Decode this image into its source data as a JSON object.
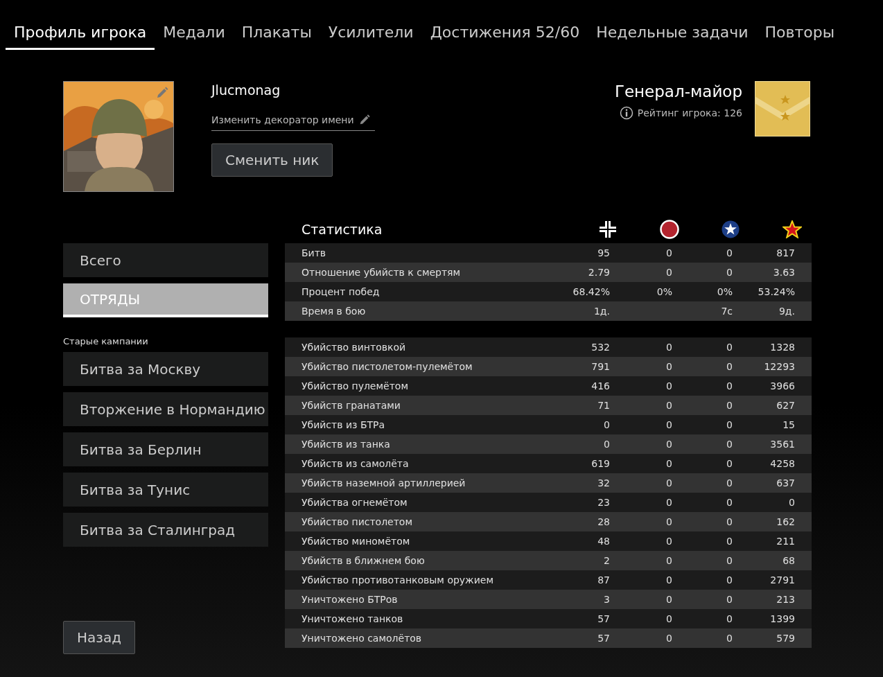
{
  "tabs": [
    {
      "label": "Профиль игрока",
      "selected": true
    },
    {
      "label": "Медали",
      "selected": false
    },
    {
      "label": "Плакаты",
      "selected": false
    },
    {
      "label": "Усилители",
      "selected": false
    },
    {
      "label": "Достижения 52/60",
      "selected": false
    },
    {
      "label": "Недельные задачи",
      "selected": false
    },
    {
      "label": "Повторы",
      "selected": false
    }
  ],
  "profile": {
    "nickname": "Jlucmonag",
    "decorator_link": "Изменить декоратор имени",
    "change_nick_button": "Сменить ник",
    "rank": "Генерал-майор",
    "rating": "Рейтинг игрока: 126"
  },
  "sidebar": {
    "items": [
      {
        "label": "Всего",
        "selected": false
      },
      {
        "label": "ОТРЯДЫ",
        "selected": true
      }
    ],
    "section_label": "Старые кампании",
    "campaigns": [
      {
        "label": "Битва за Москву",
        "selected": false
      },
      {
        "label": "Вторжение в Нормандию",
        "selected": false
      },
      {
        "label": "Битва за Берлин",
        "selected": false
      },
      {
        "label": "Битва за Тунис",
        "selected": false
      },
      {
        "label": "Битва за Сталинград",
        "selected": false
      }
    ],
    "back_button": "Назад"
  },
  "stats": {
    "title": "Статистика",
    "factions": [
      {
        "kind": "cross"
      },
      {
        "kind": "disc"
      },
      {
        "kind": "roundel"
      },
      {
        "kind": "star"
      }
    ],
    "groups": [
      [
        {
          "label": "Битв",
          "values": {
            "cross": "95",
            "disc": "0",
            "roundel": "0",
            "star": "817"
          }
        },
        {
          "label": "Отношение убийств к смертям",
          "values": {
            "cross": "2.79",
            "disc": "0",
            "roundel": "0",
            "star": "3.63"
          }
        },
        {
          "label": "Процент побед",
          "values": {
            "cross": "68.42%",
            "disc": "0%",
            "roundel": "0%",
            "star": "53.24%"
          }
        },
        {
          "label": "Время в бою",
          "values": {
            "cross": "1д.",
            "roundel": "7с",
            "star": "9д."
          }
        }
      ],
      [
        {
          "label": "Убийство винтовкой",
          "values": {
            "cross": "532",
            "disc": "0",
            "roundel": "0",
            "star": "1328"
          }
        },
        {
          "label": "Убийство пистолетом-пулемётом",
          "values": {
            "cross": "791",
            "disc": "0",
            "roundel": "0",
            "star": "12293"
          }
        },
        {
          "label": "Убийство пулемётом",
          "values": {
            "cross": "416",
            "disc": "0",
            "roundel": "0",
            "star": "3966"
          }
        },
        {
          "label": "Убийств гранатами",
          "values": {
            "cross": "71",
            "disc": "0",
            "roundel": "0",
            "star": "627"
          }
        },
        {
          "label": "Убийств из БТРа",
          "values": {
            "cross": "0",
            "disc": "0",
            "roundel": "0",
            "star": "15"
          }
        },
        {
          "label": "Убийств из танка",
          "values": {
            "cross": "0",
            "disc": "0",
            "roundel": "0",
            "star": "3561"
          }
        },
        {
          "label": "Убийств из самолёта",
          "values": {
            "cross": "619",
            "disc": "0",
            "roundel": "0",
            "star": "4258"
          }
        },
        {
          "label": "Убийств наземной артиллерией",
          "values": {
            "cross": "32",
            "disc": "0",
            "roundel": "0",
            "star": "637"
          }
        },
        {
          "label": "Убийства огнемётом",
          "values": {
            "cross": "23",
            "disc": "0",
            "roundel": "0",
            "star": "0"
          }
        },
        {
          "label": "Убийство пистолетом",
          "values": {
            "cross": "28",
            "disc": "0",
            "roundel": "0",
            "star": "162"
          }
        },
        {
          "label": "Убийство миномётом",
          "values": {
            "cross": "48",
            "disc": "0",
            "roundel": "0",
            "star": "211"
          }
        },
        {
          "label": "Убийств в ближнем бою",
          "values": {
            "cross": "2",
            "disc": "0",
            "roundel": "0",
            "star": "68"
          }
        },
        {
          "label": "Убийство противотанковым оружием",
          "values": {
            "cross": "87",
            "disc": "0",
            "roundel": "0",
            "star": "2791"
          }
        },
        {
          "label": "Уничтожено БТРов",
          "values": {
            "cross": "3",
            "disc": "0",
            "roundel": "0",
            "star": "213"
          }
        },
        {
          "label": "Уничтожено танков",
          "values": {
            "cross": "57",
            "disc": "0",
            "roundel": "0",
            "star": "1399"
          }
        },
        {
          "label": "Уничтожено самолётов",
          "values": {
            "cross": "57",
            "disc": "0",
            "roundel": "0",
            "star": "579"
          }
        }
      ]
    ]
  }
}
